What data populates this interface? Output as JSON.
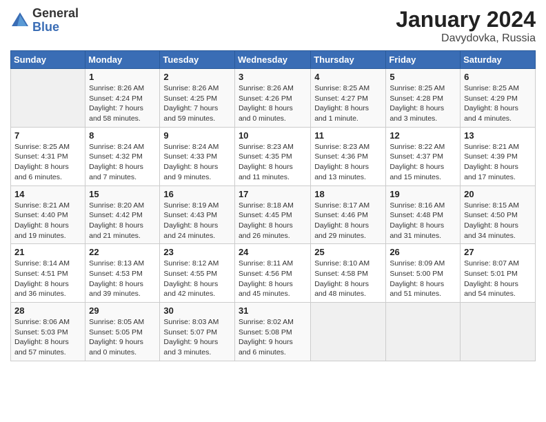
{
  "header": {
    "logo_general": "General",
    "logo_blue": "Blue",
    "month_title": "January 2024",
    "location": "Davydovka, Russia"
  },
  "weekdays": [
    "Sunday",
    "Monday",
    "Tuesday",
    "Wednesday",
    "Thursday",
    "Friday",
    "Saturday"
  ],
  "weeks": [
    [
      {
        "day": "",
        "info": ""
      },
      {
        "day": "1",
        "info": "Sunrise: 8:26 AM\nSunset: 4:24 PM\nDaylight: 7 hours\nand 58 minutes."
      },
      {
        "day": "2",
        "info": "Sunrise: 8:26 AM\nSunset: 4:25 PM\nDaylight: 7 hours\nand 59 minutes."
      },
      {
        "day": "3",
        "info": "Sunrise: 8:26 AM\nSunset: 4:26 PM\nDaylight: 8 hours\nand 0 minutes."
      },
      {
        "day": "4",
        "info": "Sunrise: 8:25 AM\nSunset: 4:27 PM\nDaylight: 8 hours\nand 1 minute."
      },
      {
        "day": "5",
        "info": "Sunrise: 8:25 AM\nSunset: 4:28 PM\nDaylight: 8 hours\nand 3 minutes."
      },
      {
        "day": "6",
        "info": "Sunrise: 8:25 AM\nSunset: 4:29 PM\nDaylight: 8 hours\nand 4 minutes."
      }
    ],
    [
      {
        "day": "7",
        "info": "Sunrise: 8:25 AM\nSunset: 4:31 PM\nDaylight: 8 hours\nand 6 minutes."
      },
      {
        "day": "8",
        "info": "Sunrise: 8:24 AM\nSunset: 4:32 PM\nDaylight: 8 hours\nand 7 minutes."
      },
      {
        "day": "9",
        "info": "Sunrise: 8:24 AM\nSunset: 4:33 PM\nDaylight: 8 hours\nand 9 minutes."
      },
      {
        "day": "10",
        "info": "Sunrise: 8:23 AM\nSunset: 4:35 PM\nDaylight: 8 hours\nand 11 minutes."
      },
      {
        "day": "11",
        "info": "Sunrise: 8:23 AM\nSunset: 4:36 PM\nDaylight: 8 hours\nand 13 minutes."
      },
      {
        "day": "12",
        "info": "Sunrise: 8:22 AM\nSunset: 4:37 PM\nDaylight: 8 hours\nand 15 minutes."
      },
      {
        "day": "13",
        "info": "Sunrise: 8:21 AM\nSunset: 4:39 PM\nDaylight: 8 hours\nand 17 minutes."
      }
    ],
    [
      {
        "day": "14",
        "info": "Sunrise: 8:21 AM\nSunset: 4:40 PM\nDaylight: 8 hours\nand 19 minutes."
      },
      {
        "day": "15",
        "info": "Sunrise: 8:20 AM\nSunset: 4:42 PM\nDaylight: 8 hours\nand 21 minutes."
      },
      {
        "day": "16",
        "info": "Sunrise: 8:19 AM\nSunset: 4:43 PM\nDaylight: 8 hours\nand 24 minutes."
      },
      {
        "day": "17",
        "info": "Sunrise: 8:18 AM\nSunset: 4:45 PM\nDaylight: 8 hours\nand 26 minutes."
      },
      {
        "day": "18",
        "info": "Sunrise: 8:17 AM\nSunset: 4:46 PM\nDaylight: 8 hours\nand 29 minutes."
      },
      {
        "day": "19",
        "info": "Sunrise: 8:16 AM\nSunset: 4:48 PM\nDaylight: 8 hours\nand 31 minutes."
      },
      {
        "day": "20",
        "info": "Sunrise: 8:15 AM\nSunset: 4:50 PM\nDaylight: 8 hours\nand 34 minutes."
      }
    ],
    [
      {
        "day": "21",
        "info": "Sunrise: 8:14 AM\nSunset: 4:51 PM\nDaylight: 8 hours\nand 36 minutes."
      },
      {
        "day": "22",
        "info": "Sunrise: 8:13 AM\nSunset: 4:53 PM\nDaylight: 8 hours\nand 39 minutes."
      },
      {
        "day": "23",
        "info": "Sunrise: 8:12 AM\nSunset: 4:55 PM\nDaylight: 8 hours\nand 42 minutes."
      },
      {
        "day": "24",
        "info": "Sunrise: 8:11 AM\nSunset: 4:56 PM\nDaylight: 8 hours\nand 45 minutes."
      },
      {
        "day": "25",
        "info": "Sunrise: 8:10 AM\nSunset: 4:58 PM\nDaylight: 8 hours\nand 48 minutes."
      },
      {
        "day": "26",
        "info": "Sunrise: 8:09 AM\nSunset: 5:00 PM\nDaylight: 8 hours\nand 51 minutes."
      },
      {
        "day": "27",
        "info": "Sunrise: 8:07 AM\nSunset: 5:01 PM\nDaylight: 8 hours\nand 54 minutes."
      }
    ],
    [
      {
        "day": "28",
        "info": "Sunrise: 8:06 AM\nSunset: 5:03 PM\nDaylight: 8 hours\nand 57 minutes."
      },
      {
        "day": "29",
        "info": "Sunrise: 8:05 AM\nSunset: 5:05 PM\nDaylight: 9 hours\nand 0 minutes."
      },
      {
        "day": "30",
        "info": "Sunrise: 8:03 AM\nSunset: 5:07 PM\nDaylight: 9 hours\nand 3 minutes."
      },
      {
        "day": "31",
        "info": "Sunrise: 8:02 AM\nSunset: 5:08 PM\nDaylight: 9 hours\nand 6 minutes."
      },
      {
        "day": "",
        "info": ""
      },
      {
        "day": "",
        "info": ""
      },
      {
        "day": "",
        "info": ""
      }
    ]
  ]
}
